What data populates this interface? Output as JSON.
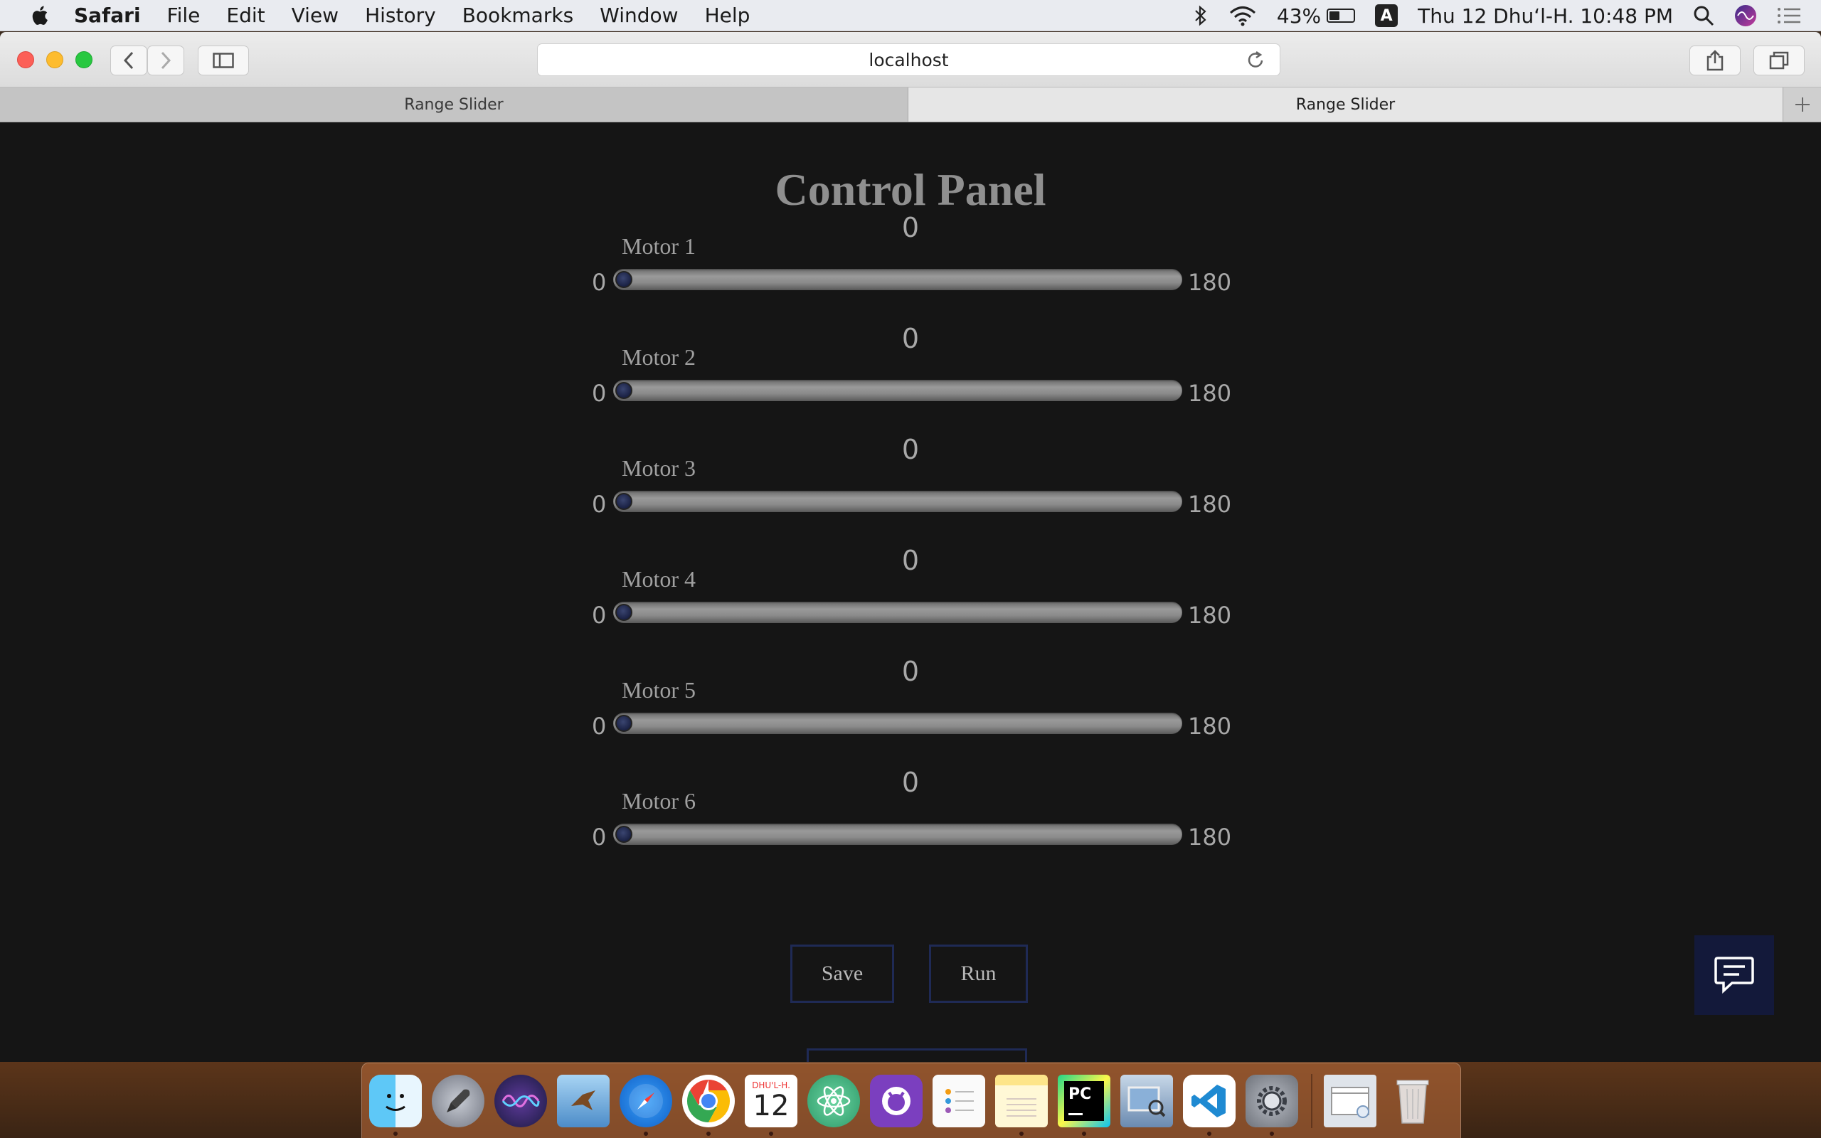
{
  "menubar": {
    "app_name": "Safari",
    "items": [
      "File",
      "Edit",
      "View",
      "History",
      "Bookmarks",
      "Window",
      "Help"
    ],
    "battery_percent": "43%",
    "battery_level": 0.43,
    "input_source": "A",
    "datetime": "Thu 12 Dhuʻl-H.  10:48 PM"
  },
  "browser": {
    "url": "localhost",
    "tabs": [
      {
        "title": "Range Slider",
        "active": false
      },
      {
        "title": "Range Slider",
        "active": true
      }
    ]
  },
  "page": {
    "title": "Control Panel",
    "motors": [
      {
        "label": "Motor 1",
        "value": "0",
        "min": "0",
        "max": "180"
      },
      {
        "label": "Motor 2",
        "value": "0",
        "min": "0",
        "max": "180"
      },
      {
        "label": "Motor 3",
        "value": "0",
        "min": "0",
        "max": "180"
      },
      {
        "label": "Motor 4",
        "value": "0",
        "min": "0",
        "max": "180"
      },
      {
        "label": "Motor 5",
        "value": "0",
        "min": "0",
        "max": "180"
      },
      {
        "label": "Motor 6",
        "value": "0",
        "min": "0",
        "max": "180"
      }
    ],
    "save_label": "Save",
    "run_label": "Run"
  },
  "dock": {
    "calendar_month": "DHU'L-H.",
    "calendar_day": "12",
    "apps": [
      "finder",
      "launchpad",
      "siri",
      "preview-bird",
      "safari",
      "chrome",
      "calendar",
      "atom",
      "github-desktop",
      "reminders",
      "notes",
      "pycharm",
      "image-capture",
      "vscode",
      "system-preferences",
      "downloads-folder",
      "trash"
    ]
  },
  "colors": {
    "page_bg": "#151515",
    "button_border": "#1f2a55",
    "knob": "#1a2144"
  }
}
